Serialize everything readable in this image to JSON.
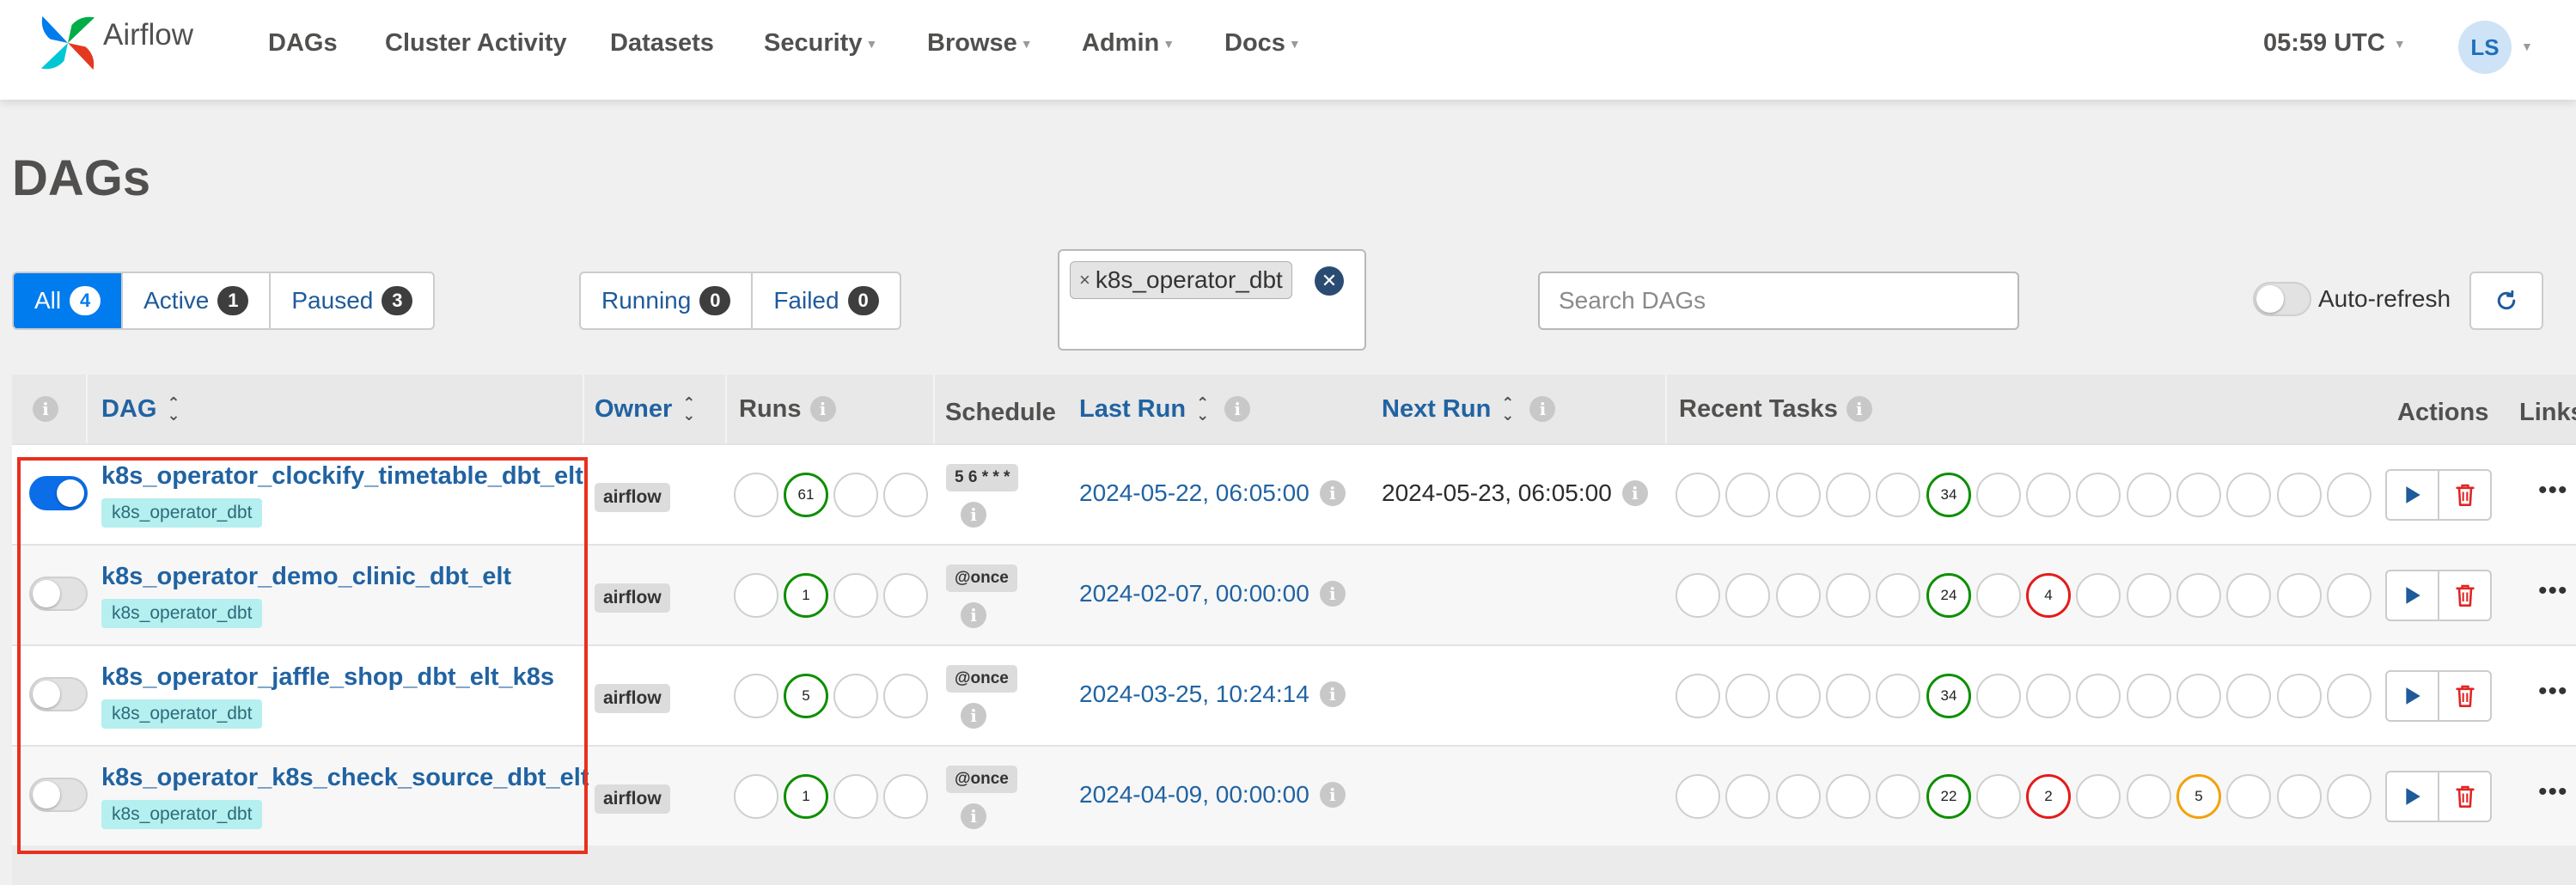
{
  "navbar": {
    "brand": "Airflow",
    "items": [
      {
        "label": "DAGs",
        "dropdown": false
      },
      {
        "label": "Cluster Activity",
        "dropdown": false
      },
      {
        "label": "Datasets",
        "dropdown": false
      },
      {
        "label": "Security",
        "dropdown": true
      },
      {
        "label": "Browse",
        "dropdown": true
      },
      {
        "label": "Admin",
        "dropdown": true
      },
      {
        "label": "Docs",
        "dropdown": true
      }
    ],
    "time": "05:59 UTC",
    "user_initials": "LS"
  },
  "page_title": "DAGs",
  "status_filters": [
    {
      "label": "All",
      "count": "4",
      "active": true
    },
    {
      "label": "Active",
      "count": "1",
      "active": false
    },
    {
      "label": "Paused",
      "count": "3",
      "active": false
    }
  ],
  "run_filters": [
    {
      "label": "Running",
      "count": "0"
    },
    {
      "label": "Failed",
      "count": "0"
    }
  ],
  "tag_filter": {
    "selected": "k8s_operator_dbt",
    "remove": "×"
  },
  "search": {
    "placeholder": "Search DAGs",
    "value": ""
  },
  "auto_refresh": {
    "label": "Auto-refresh",
    "enabled": false
  },
  "table": {
    "headers": {
      "dag": "DAG",
      "owner": "Owner",
      "runs": "Runs",
      "schedule": "Schedule",
      "last_run": "Last Run",
      "next_run": "Next Run",
      "recent_tasks": "Recent Tasks",
      "actions": "Actions",
      "links": "Links"
    },
    "rows": [
      {
        "name": "k8s_operator_clockify_timetable_dbt_elt",
        "tag": "k8s_operator_dbt",
        "active": true,
        "owner": "airflow",
        "runs": [
          {
            "value": "",
            "state": "none"
          },
          {
            "value": "61",
            "state": "success"
          },
          {
            "value": "",
            "state": "none"
          },
          {
            "value": "",
            "state": "none"
          }
        ],
        "schedule": "5 6 * * *",
        "last_run": "2024-05-22, 06:05:00",
        "next_run": "2024-05-23, 06:05:00",
        "recent_tasks": [
          {
            "value": "",
            "state": "none"
          },
          {
            "value": "",
            "state": "none"
          },
          {
            "value": "",
            "state": "none"
          },
          {
            "value": "",
            "state": "none"
          },
          {
            "value": "",
            "state": "none"
          },
          {
            "value": "34",
            "state": "success"
          },
          {
            "value": "",
            "state": "none"
          },
          {
            "value": "",
            "state": "none"
          },
          {
            "value": "",
            "state": "none"
          },
          {
            "value": "",
            "state": "none"
          },
          {
            "value": "",
            "state": "none"
          },
          {
            "value": "",
            "state": "none"
          },
          {
            "value": "",
            "state": "none"
          },
          {
            "value": "",
            "state": "none"
          }
        ]
      },
      {
        "name": "k8s_operator_demo_clinic_dbt_elt",
        "tag": "k8s_operator_dbt",
        "active": false,
        "owner": "airflow",
        "runs": [
          {
            "value": "",
            "state": "none"
          },
          {
            "value": "1",
            "state": "success"
          },
          {
            "value": "",
            "state": "none"
          },
          {
            "value": "",
            "state": "none"
          }
        ],
        "schedule": "@once",
        "last_run": "2024-02-07, 00:00:00",
        "next_run": "",
        "recent_tasks": [
          {
            "value": "",
            "state": "none"
          },
          {
            "value": "",
            "state": "none"
          },
          {
            "value": "",
            "state": "none"
          },
          {
            "value": "",
            "state": "none"
          },
          {
            "value": "",
            "state": "none"
          },
          {
            "value": "24",
            "state": "success"
          },
          {
            "value": "",
            "state": "none"
          },
          {
            "value": "4",
            "state": "failed"
          },
          {
            "value": "",
            "state": "none"
          },
          {
            "value": "",
            "state": "none"
          },
          {
            "value": "",
            "state": "none"
          },
          {
            "value": "",
            "state": "none"
          },
          {
            "value": "",
            "state": "none"
          },
          {
            "value": "",
            "state": "none"
          }
        ]
      },
      {
        "name": "k8s_operator_jaffle_shop_dbt_elt_k8s",
        "tag": "k8s_operator_dbt",
        "active": false,
        "owner": "airflow",
        "runs": [
          {
            "value": "",
            "state": "none"
          },
          {
            "value": "5",
            "state": "success"
          },
          {
            "value": "",
            "state": "none"
          },
          {
            "value": "",
            "state": "none"
          }
        ],
        "schedule": "@once",
        "last_run": "2024-03-25, 10:24:14",
        "next_run": "",
        "recent_tasks": [
          {
            "value": "",
            "state": "none"
          },
          {
            "value": "",
            "state": "none"
          },
          {
            "value": "",
            "state": "none"
          },
          {
            "value": "",
            "state": "none"
          },
          {
            "value": "",
            "state": "none"
          },
          {
            "value": "34",
            "state": "success"
          },
          {
            "value": "",
            "state": "none"
          },
          {
            "value": "",
            "state": "none"
          },
          {
            "value": "",
            "state": "none"
          },
          {
            "value": "",
            "state": "none"
          },
          {
            "value": "",
            "state": "none"
          },
          {
            "value": "",
            "state": "none"
          },
          {
            "value": "",
            "state": "none"
          },
          {
            "value": "",
            "state": "none"
          }
        ]
      },
      {
        "name": "k8s_operator_k8s_check_source_dbt_elt",
        "tag": "k8s_operator_dbt",
        "active": false,
        "owner": "airflow",
        "runs": [
          {
            "value": "",
            "state": "none"
          },
          {
            "value": "1",
            "state": "success"
          },
          {
            "value": "",
            "state": "none"
          },
          {
            "value": "",
            "state": "none"
          }
        ],
        "schedule": "@once",
        "last_run": "2024-04-09, 00:00:00",
        "next_run": "",
        "recent_tasks": [
          {
            "value": "",
            "state": "none"
          },
          {
            "value": "",
            "state": "none"
          },
          {
            "value": "",
            "state": "none"
          },
          {
            "value": "",
            "state": "none"
          },
          {
            "value": "",
            "state": "none"
          },
          {
            "value": "22",
            "state": "success"
          },
          {
            "value": "",
            "state": "none"
          },
          {
            "value": "2",
            "state": "failed"
          },
          {
            "value": "",
            "state": "none"
          },
          {
            "value": "",
            "state": "none"
          },
          {
            "value": "5",
            "state": "up_for_retry"
          },
          {
            "value": "",
            "state": "none"
          },
          {
            "value": "",
            "state": "none"
          },
          {
            "value": "",
            "state": "none"
          }
        ]
      }
    ]
  },
  "icons": {
    "info": "info-icon",
    "trigger": "play-icon",
    "delete": "trash-icon",
    "refresh": "refresh-icon",
    "more": "ellipsis-icon"
  },
  "colors": {
    "accent": "#017cee",
    "link": "#2163a2",
    "success": "#0d8f00",
    "failed": "#e41b1b",
    "up_for_retry": "#f2a20c",
    "delete": "#e02424",
    "highlight": "#e8301d"
  }
}
